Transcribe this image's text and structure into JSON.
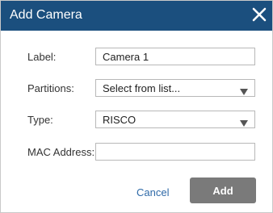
{
  "dialog": {
    "title": "Add Camera",
    "close_icon": "close-icon"
  },
  "form": {
    "label": {
      "label": "Label:",
      "value": "Camera 1"
    },
    "partitions": {
      "label": "Partitions:",
      "value": "Select from list...",
      "icon": "chevron-down-icon"
    },
    "type": {
      "label": "Type:",
      "value": "RISCO",
      "icon": "chevron-down-icon"
    },
    "mac_address": {
      "label": "MAC Address:",
      "value": ""
    }
  },
  "actions": {
    "cancel_label": "Cancel",
    "add_label": "Add"
  },
  "colors": {
    "titlebar": "#1b4f7e",
    "link": "#2f6aa8",
    "add_button": "#7a7a7a"
  }
}
